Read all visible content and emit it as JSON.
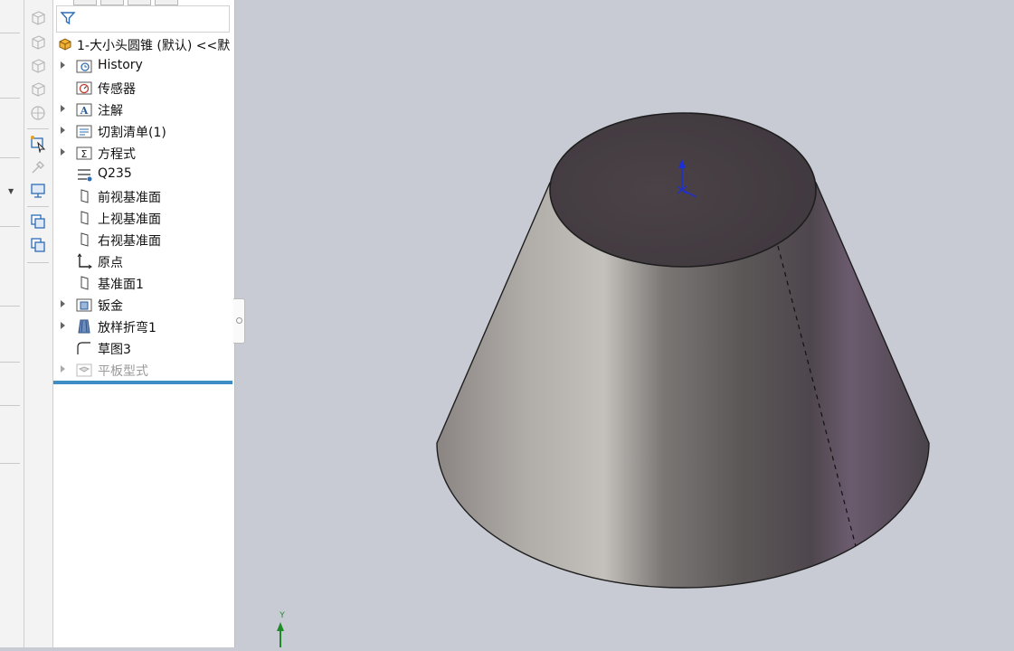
{
  "feature_tree": {
    "root_label": "1-大小头圆锥 (默认) <<默",
    "items": [
      {
        "label": "History",
        "icon": "history-folder-icon",
        "expandable": true
      },
      {
        "label": "传感器",
        "icon": "sensor-icon",
        "expandable": false
      },
      {
        "label": "注解",
        "icon": "annotation-icon",
        "expandable": true
      },
      {
        "label": "切割清单(1)",
        "icon": "cut-list-icon",
        "expandable": true
      },
      {
        "label": "方程式",
        "icon": "equation-icon",
        "expandable": true
      },
      {
        "label": "Q235",
        "icon": "material-icon",
        "expandable": false
      },
      {
        "label": "前视基准面",
        "icon": "plane-icon",
        "expandable": false
      },
      {
        "label": "上视基准面",
        "icon": "plane-icon",
        "expandable": false
      },
      {
        "label": "右视基准面",
        "icon": "plane-icon",
        "expandable": false
      },
      {
        "label": "原点",
        "icon": "origin-icon",
        "expandable": false
      },
      {
        "label": "基准面1",
        "icon": "plane-icon",
        "expandable": false
      },
      {
        "label": "钣金",
        "icon": "sheet-metal-icon",
        "expandable": true
      },
      {
        "label": "放样折弯1",
        "icon": "lofted-bend-icon",
        "expandable": true
      },
      {
        "label": "草图3",
        "icon": "sketch-icon",
        "expandable": false
      },
      {
        "label": "平板型式",
        "icon": "flat-pattern-icon",
        "expandable": true,
        "suppressed": true
      }
    ]
  },
  "triad": {
    "y_label": "Y"
  },
  "colors": {
    "viewport_bg": "#c8cbd4",
    "rollback_bar": "#3d8ec6",
    "triad_axis": "#1c2fd6",
    "triad_y": "#1e8a28"
  }
}
